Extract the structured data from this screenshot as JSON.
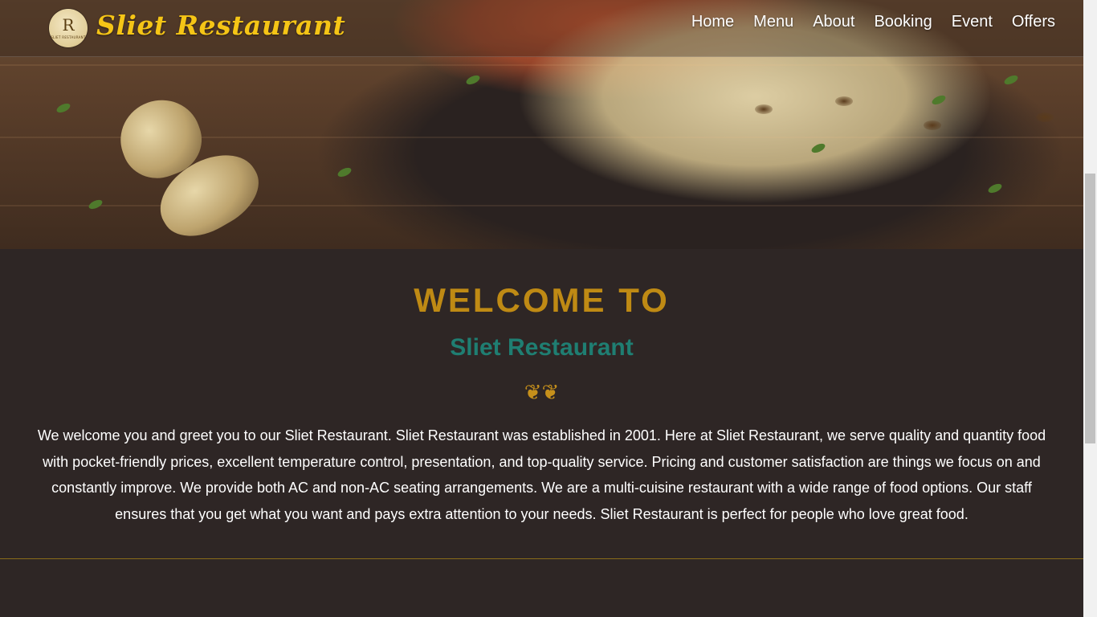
{
  "header": {
    "logo_monogram": "R",
    "logo_caption": "SLIET RESTAURANT",
    "brand_name": "Sliet Restaurant",
    "nav": [
      "Home",
      "Menu",
      "About",
      "Booking",
      "Event",
      "Offers"
    ]
  },
  "welcome": {
    "heading": "WELCOME TO",
    "subheading": "Sliet Restaurant",
    "ornament": "❦❦",
    "body": "We welcome you and greet you to our Sliet Restaurant. Sliet Restaurant was established in 2001. Here at Sliet Restaurant, we serve quality and quantity food with pocket-friendly prices, excellent temperature control, presentation, and top-quality service. Pricing and customer satisfaction are things we focus on and constantly improve. We provide both AC and non-AC seating arrangements. We are a multi-cuisine restaurant with a wide range of food options. Our staff ensures that you get what you want and pays extra attention to your needs. Sliet Restaurant is perfect for people who love great food."
  },
  "colors": {
    "background": "#2e2625",
    "heading_gold": "#bf8a14",
    "subheading_teal": "#1f7e72",
    "brand_yellow": "#f5c516"
  }
}
